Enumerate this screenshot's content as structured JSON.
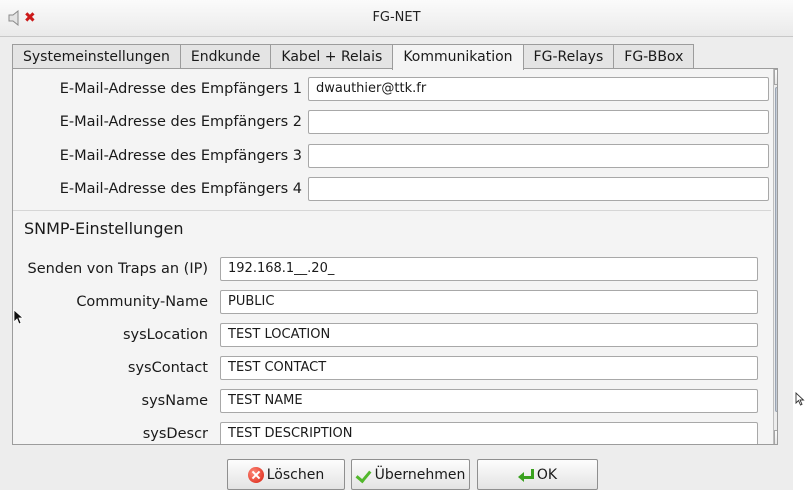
{
  "window": {
    "title": "FG-NET"
  },
  "tabs": [
    {
      "label": "Systemeinstellungen",
      "active": false
    },
    {
      "label": "Endkunde",
      "active": false
    },
    {
      "label": "Kabel + Relais",
      "active": false
    },
    {
      "label": "Kommunikation",
      "active": true
    },
    {
      "label": "FG-Relays",
      "active": false
    },
    {
      "label": "FG-BBox",
      "active": false
    }
  ],
  "email": {
    "rows": [
      {
        "label": "E-Mail-Adresse des Empfängers 1",
        "value": "dwauthier@ttk.fr"
      },
      {
        "label": "E-Mail-Adresse des Empfängers 2",
        "value": ""
      },
      {
        "label": "E-Mail-Adresse des Empfängers 3",
        "value": ""
      },
      {
        "label": "E-Mail-Adresse des Empfängers 4",
        "value": ""
      }
    ]
  },
  "snmp": {
    "section_title": "SNMP-Einstellungen",
    "rows": [
      {
        "label": "Senden von Traps an (IP)",
        "value": "192.168.1__.20_"
      },
      {
        "label": "Community-Name",
        "value": "PUBLIC"
      },
      {
        "label": "sysLocation",
        "value": "TEST LOCATION"
      },
      {
        "label": "sysContact",
        "value": "TEST CONTACT"
      },
      {
        "label": "sysName",
        "value": "TEST NAME"
      },
      {
        "label": "sysDescr",
        "value": "TEST DESCRIPTION"
      }
    ]
  },
  "buttons": {
    "delete_label": "Löschen",
    "apply_label": "Übernehmen",
    "ok_label": "OK"
  },
  "icons": {
    "window_menu": "speaker-icon",
    "window_close": "close-icon",
    "delete": "delete-icon",
    "apply": "checkmark-icon",
    "ok": "enter-arrow-icon"
  },
  "colors": {
    "close_red": "#cc1a1a",
    "delete_red": "#d81f0f",
    "check_green": "#52b82c",
    "scroll_thumb": "#b3bcc9"
  }
}
